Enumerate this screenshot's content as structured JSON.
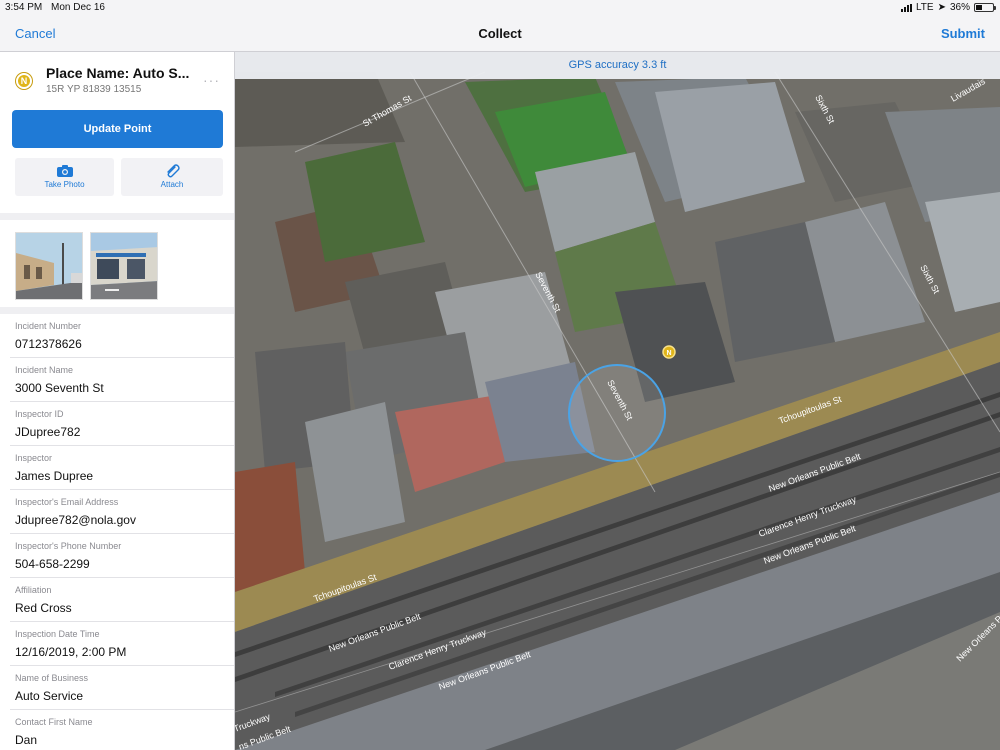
{
  "status_bar": {
    "time": "3:54 PM",
    "date": "Mon Dec 16",
    "network": "LTE",
    "battery": "36%",
    "battery_level": 0.36
  },
  "nav": {
    "cancel": "Cancel",
    "title": "Collect",
    "submit": "Submit"
  },
  "gps_banner": "GPS accuracy 3.3 ft",
  "panel": {
    "place_name": "Place Name: Auto S...",
    "place_coord": "15R YP 81839 13515",
    "more": "···",
    "update_button": "Update Point",
    "take_photo": "Take Photo",
    "attach": "Attach",
    "fields": [
      {
        "label": "Incident Number",
        "value": "0712378626"
      },
      {
        "label": "Incident Name",
        "value": "3000 Seventh St"
      },
      {
        "label": "Inspector ID",
        "value": "JDupree782"
      },
      {
        "label": "Inspector",
        "value": "James Dupree"
      },
      {
        "label": "Inspector's Email Address",
        "value": "Jdupree782@nola.gov"
      },
      {
        "label": "Inspector's Phone Number",
        "value": "504-658-2299"
      },
      {
        "label": "Affiliation",
        "value": "Red Cross"
      },
      {
        "label": "Inspection Date Time",
        "value": "12/16/2019, 2:00 PM"
      },
      {
        "label": "Name of Business",
        "value": "Auto Service"
      },
      {
        "label": "Contact First Name",
        "value": "Dan"
      }
    ]
  },
  "map": {
    "streets": {
      "st_thomas": "St Thomas St",
      "seventh_upper": "Seventh St",
      "seventh_lower": "Seventh St",
      "sixth_upper": "Sixth St",
      "sixth_lower": "Sixth St",
      "livaudais": "Livaudais",
      "tchoupitoulas_right": "Tchoupitoulas St",
      "tchoupitoulas_left": "Tchoupitoulas St",
      "nopb_1": "New Orleans Public Belt",
      "nopb_2": "New Orleans Public Belt",
      "nopb_3": "New Orleans Public Belt",
      "nopb_4": "New Orleans Public Belt",
      "nopb_5": "New Orleans Public Belt",
      "nopb_6": "New Orleans Public Belt",
      "clarence_1": "Clarence Henry Truckway",
      "clarence_2": "Clarence Henry Truckway",
      "truckway_edge": "Truckway",
      "belt_edge": "ns Public Belt"
    },
    "pin_glyph": "N",
    "colors": {
      "accent": "#1f7ad6",
      "road_band": "#9c8a52",
      "pin": "#e0b51a"
    }
  }
}
